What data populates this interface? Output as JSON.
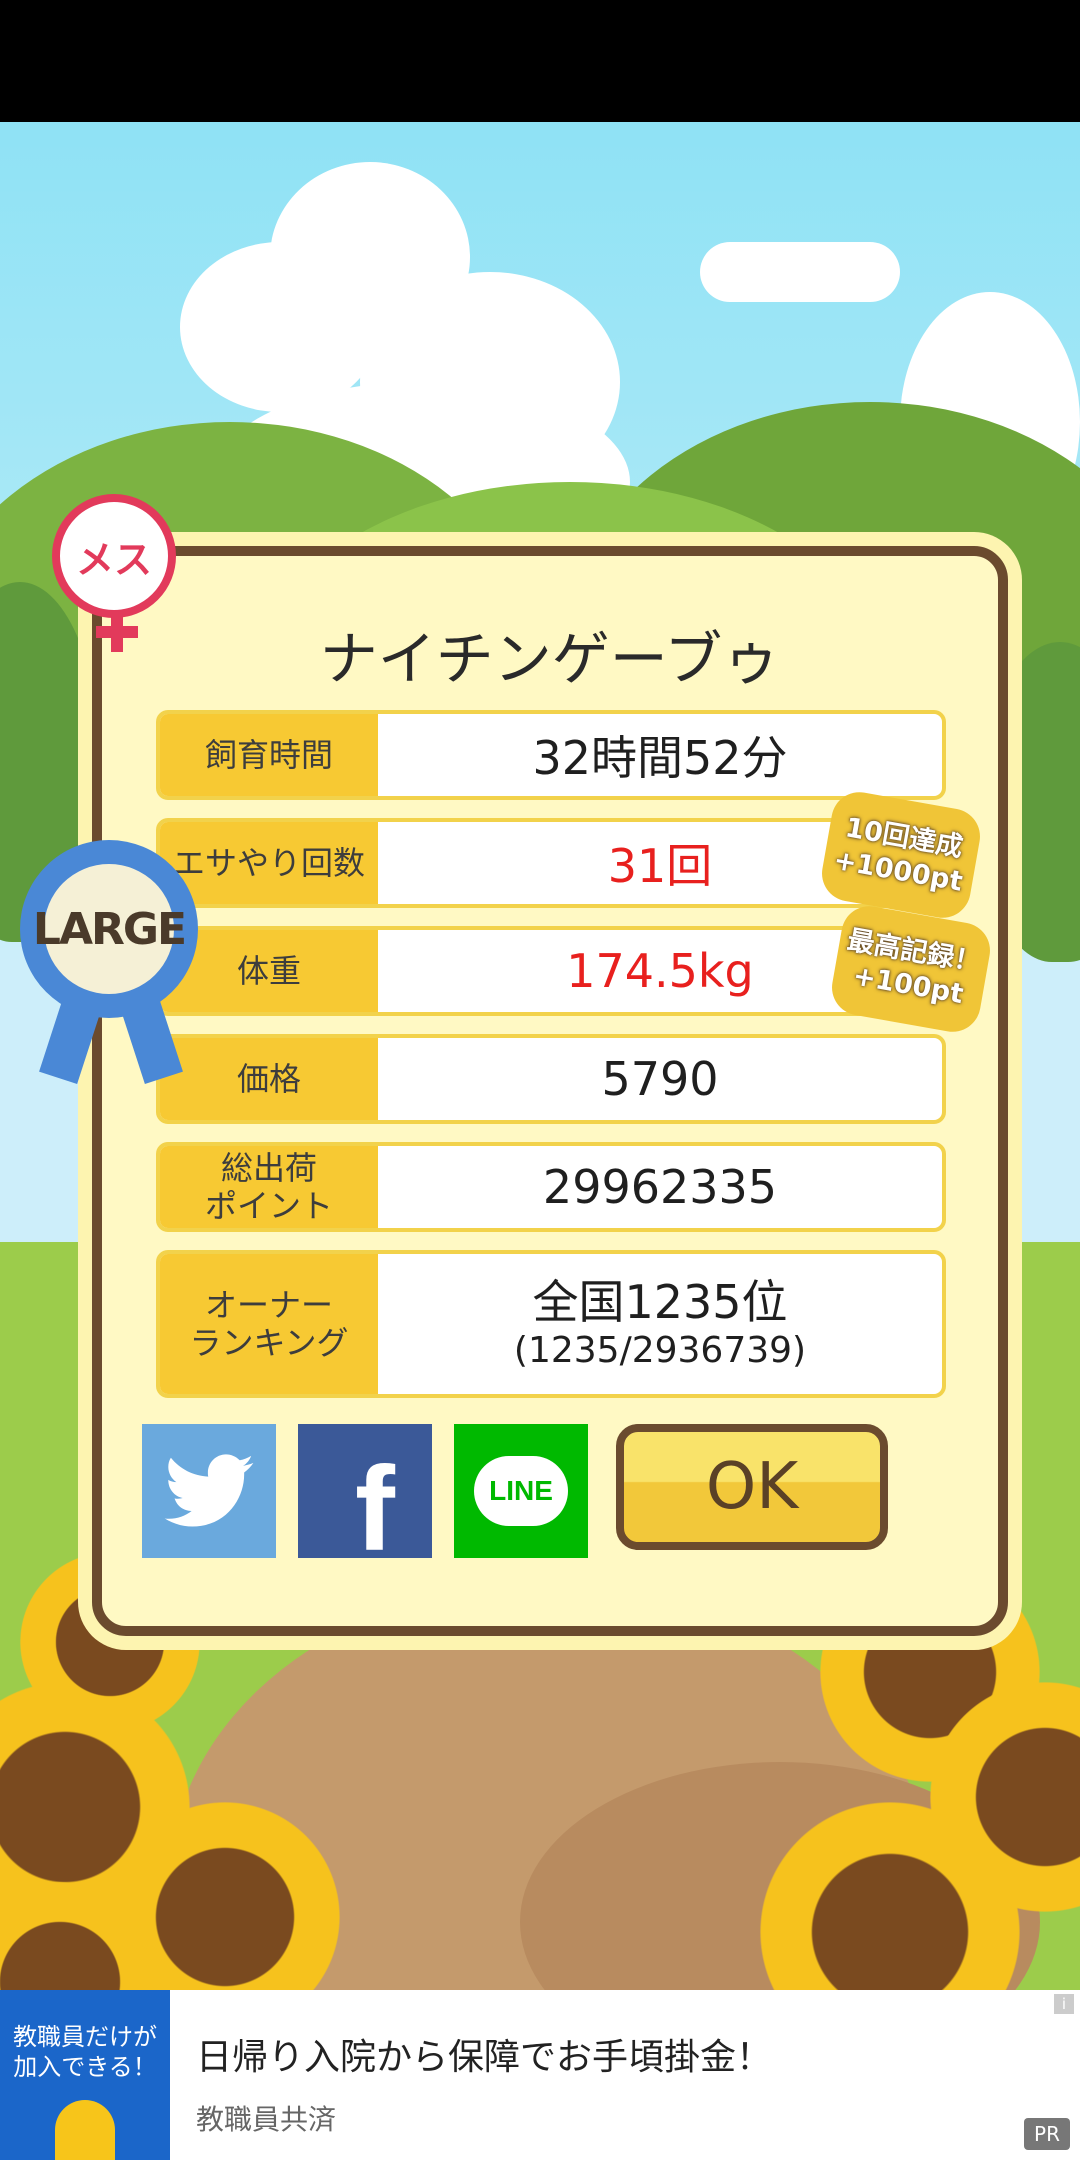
{
  "result": {
    "gender_badge": "メス",
    "size_badge": "LARGE",
    "name": "ナイチンゲーブゥ",
    "rows": [
      {
        "label": "飼育時間",
        "value": "32時間52分"
      },
      {
        "label": "エサやり回数",
        "value": "31回"
      },
      {
        "label": "体重",
        "value": "174.5kg"
      },
      {
        "label": "価格",
        "value": "5790"
      },
      {
        "label_line1": "総出荷",
        "label_line2": "ポイント",
        "value": "29962335"
      },
      {
        "label_line1": "オーナー",
        "label_line2": "ランキング",
        "value_main": "全国1235位",
        "value_sub": "(1235/2936739)"
      }
    ],
    "bonuses": [
      {
        "line1": "10回達成",
        "line2": "+1000pt"
      },
      {
        "line1": "最高記録！",
        "line2": "+100pt"
      }
    ],
    "share": {
      "twitter": "twitter-share",
      "facebook": "f",
      "line": "LINE"
    },
    "ok_label": "OK"
  },
  "ad": {
    "image_text_line1": "教職員だけが",
    "image_text_line2": "加入できる！",
    "title": "日帰り入院から保障でお手頃掛金！",
    "advertiser": "教職員共済",
    "info": "i",
    "pr": "PR"
  }
}
